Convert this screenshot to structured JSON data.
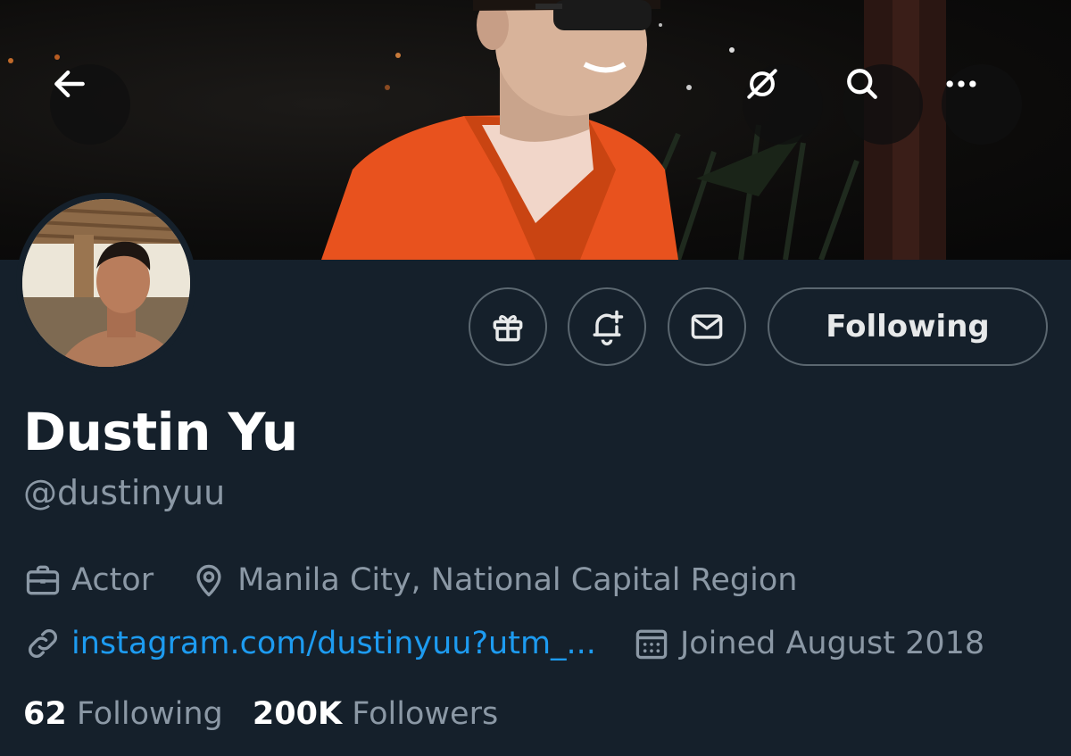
{
  "header": {
    "back_icon": "arrow-left-icon",
    "grok_icon": "grok-icon",
    "search_icon": "search-icon",
    "more_icon": "more-horizontal-icon"
  },
  "actions": {
    "gift_icon": "gift-icon",
    "notify_icon": "bell-plus-icon",
    "message_icon": "envelope-icon",
    "follow_label": "Following"
  },
  "profile": {
    "name": "Dustin Yu",
    "handle": "@dustinyuu",
    "profession": "Actor",
    "location": "Manila City, National Capital Region",
    "website": "instagram.com/dustinyuu?utm_...",
    "joined": "Joined August 2018"
  },
  "stats": {
    "following_count": "62",
    "following_label": "Following",
    "followers_count": "200K",
    "followers_label": "Followers"
  },
  "colors": {
    "background": "#15202b",
    "link": "#1d9bf0",
    "muted": "#8b98a5",
    "border": "#5b6770"
  }
}
